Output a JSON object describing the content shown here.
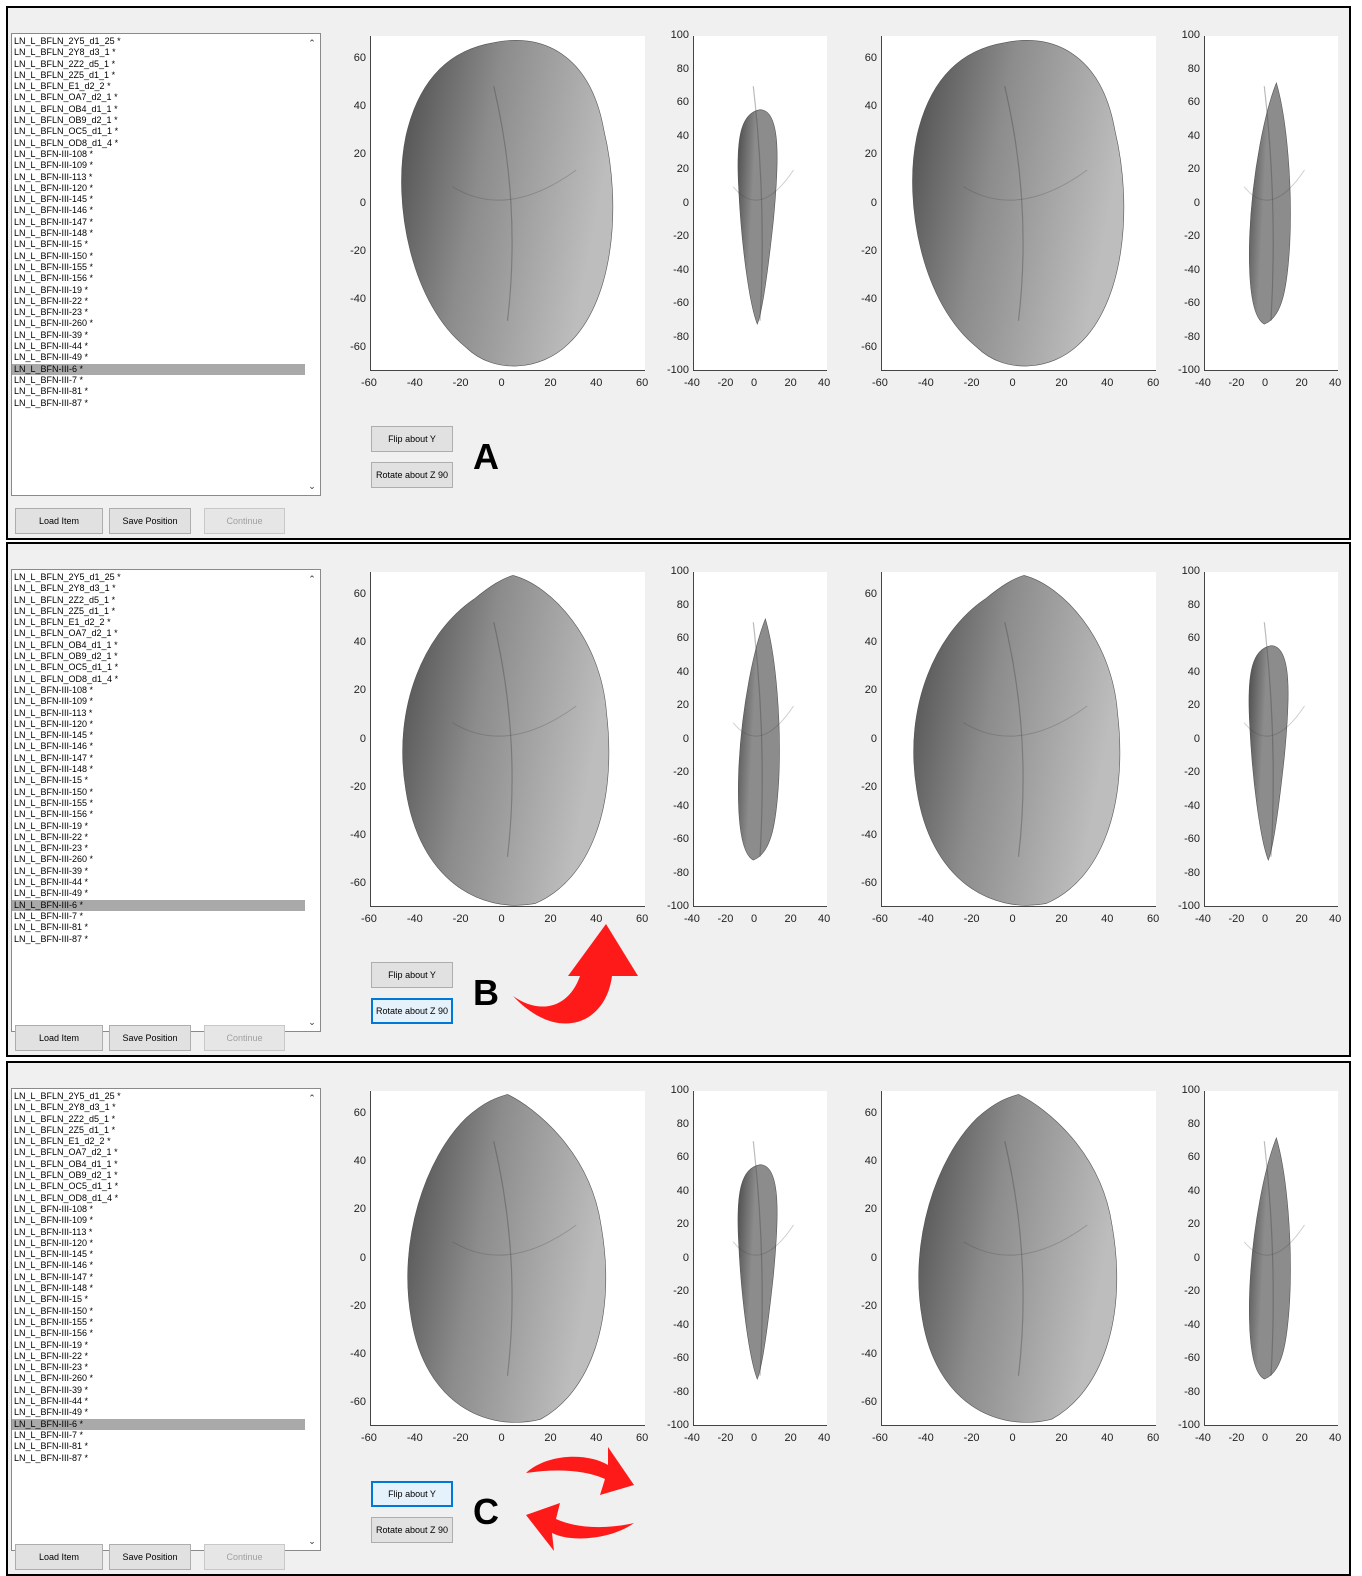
{
  "list_items": [
    "LN_L_BFLN_2Y5_d1_25 *",
    "LN_L_BFLN_2Y8_d3_1 *",
    "LN_L_BFLN_2Z2_d5_1 *",
    "LN_L_BFLN_2Z5_d1_1 *",
    "LN_L_BFLN_E1_d2_2 *",
    "LN_L_BFLN_OA7_d2_1 *",
    "LN_L_BFLN_OB4_d1_1 *",
    "LN_L_BFLN_OB9_d2_1 *",
    "LN_L_BFLN_OC5_d1_1 *",
    "LN_L_BFLN_OD8_d1_4 *",
    "LN_L_BFN-III-108 *",
    "LN_L_BFN-III-109 *",
    "LN_L_BFN-III-113 *",
    "LN_L_BFN-III-120 *",
    "LN_L_BFN-III-145 *",
    "LN_L_BFN-III-146 *",
    "LN_L_BFN-III-147 *",
    "LN_L_BFN-III-148 *",
    "LN_L_BFN-III-15 *",
    "LN_L_BFN-III-150 *",
    "LN_L_BFN-III-155 *",
    "LN_L_BFN-III-156 *",
    "LN_L_BFN-III-19 *",
    "LN_L_BFN-III-22 *",
    "LN_L_BFN-III-23 *",
    "LN_L_BFN-III-260 *",
    "LN_L_BFN-III-39 *",
    "LN_L_BFN-III-44 *",
    "LN_L_BFN-III-49 *",
    "LN_L_BFN-III-6 *",
    "LN_L_BFN-III-7 *",
    "LN_L_BFN-III-81 *",
    "LN_L_BFN-III-87 *"
  ],
  "selected_index": 29,
  "buttons": {
    "load": "Load Item",
    "save": "Save Position",
    "continue": "Continue",
    "flip": "Flip about Y",
    "rotate": "Rotate about Z 90"
  },
  "panels": [
    {
      "label": "A",
      "focused": "",
      "arrow": "none"
    },
    {
      "label": "B",
      "focused": "rotate",
      "arrow": "curved-up-right-arrow-icon"
    },
    {
      "label": "C",
      "focused": "flip",
      "arrow": "swap-arrows-icon"
    }
  ],
  "axes": {
    "front_x_ticks": [
      -60,
      -40,
      -20,
      0,
      20,
      40,
      60
    ],
    "front_y_ticks": [
      60,
      40,
      20,
      0,
      -20,
      -40,
      -60
    ],
    "side_x_ticks": [
      -40,
      -20,
      0,
      20,
      40
    ],
    "side_y_ticks": [
      100,
      80,
      60,
      40,
      20,
      0,
      -20,
      -40,
      -60,
      -80,
      -100
    ]
  },
  "colors": {
    "arrow": "#ff1a1a",
    "focus": "#0078d7",
    "selection": "#a9a9a9",
    "stone_dark": "#4a4a4a",
    "stone_mid": "#8c8c8c",
    "stone_light": "#bdbdbd"
  }
}
